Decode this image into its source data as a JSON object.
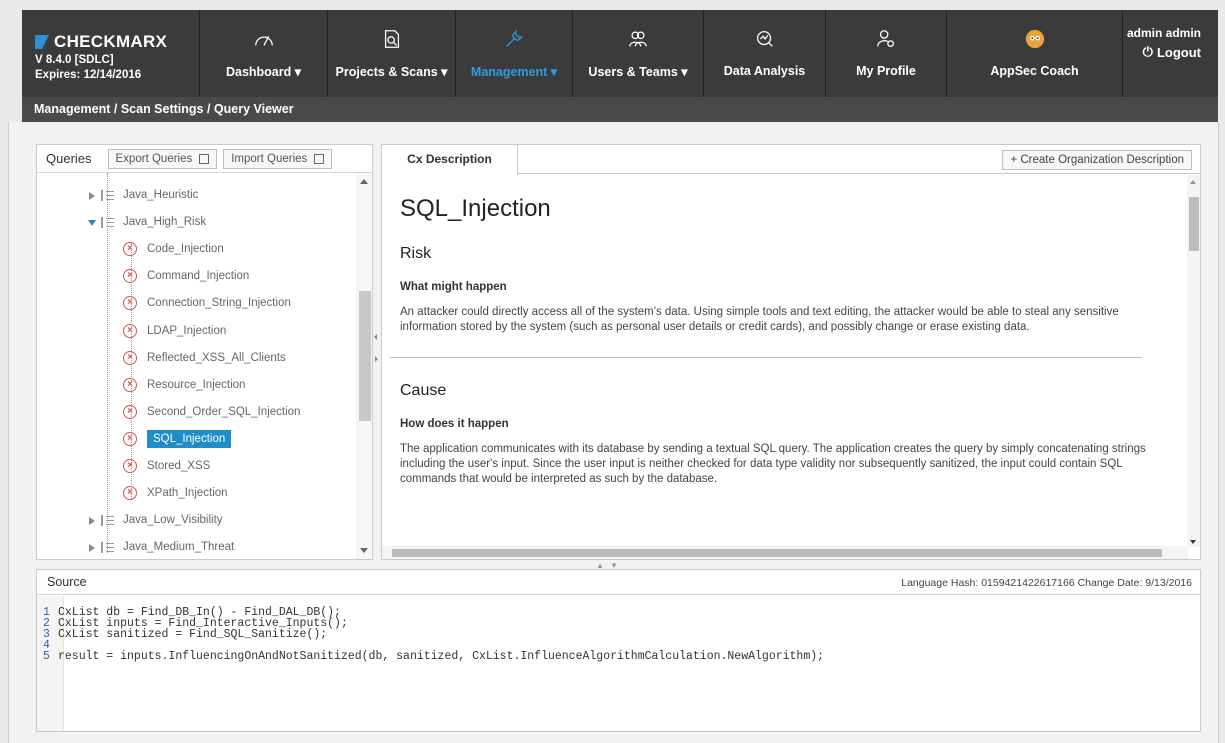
{
  "brand": {
    "name": "CHECKMARX",
    "version": "V 8.4.0  [SDLC]",
    "expires": "Expires: 12/14/2016"
  },
  "nav": [
    {
      "label": "Dashboard",
      "icon": "gauge-icon",
      "dropdown": true
    },
    {
      "label": "Projects & Scans",
      "icon": "document-search-icon",
      "dropdown": true
    },
    {
      "label": "Management",
      "icon": "wrench-icon",
      "dropdown": true,
      "active": true
    },
    {
      "label": "Users & Teams",
      "icon": "users-icon",
      "dropdown": true
    },
    {
      "label": "Data Analysis",
      "icon": "analysis-icon",
      "dropdown": false
    },
    {
      "label": "My Profile",
      "icon": "profile-gear-icon",
      "dropdown": false
    },
    {
      "label": "AppSec Coach",
      "icon": "owl-icon",
      "dropdown": false
    }
  ],
  "user": {
    "name": "admin admin",
    "logout": "Logout"
  },
  "breadcrumb": "Management / Scan Settings / Query Viewer",
  "queries": {
    "title": "Queries",
    "export_label": "Export Queries",
    "import_label": "Import Queries",
    "tree": [
      {
        "label": "Java_Heuristic",
        "type": "group"
      },
      {
        "label": "Java_High_Risk",
        "type": "group",
        "expanded": true
      },
      {
        "label": "Code_Injection",
        "type": "query"
      },
      {
        "label": "Command_Injection",
        "type": "query"
      },
      {
        "label": "Connection_String_Injection",
        "type": "query"
      },
      {
        "label": "LDAP_Injection",
        "type": "query"
      },
      {
        "label": "Reflected_XSS_All_Clients",
        "type": "query"
      },
      {
        "label": "Resource_Injection",
        "type": "query"
      },
      {
        "label": "Second_Order_SQL_Injection",
        "type": "query"
      },
      {
        "label": "SQL_Injection",
        "type": "query",
        "selected": true
      },
      {
        "label": "Stored_XSS",
        "type": "query"
      },
      {
        "label": "XPath_Injection",
        "type": "query"
      },
      {
        "label": "Java_Low_Visibility",
        "type": "group"
      },
      {
        "label": "Java_Medium_Threat",
        "type": "group"
      }
    ]
  },
  "description": {
    "tab": "Cx Description",
    "create_button": "+ Create Organization Description",
    "title": "SQL_Injection",
    "risk_heading": "Risk",
    "risk_sub": "What might happen",
    "risk_text": "An attacker could directly access all of the system's data. Using simple tools and text editing, the attacker would be able to steal any sensitive information stored by the system (such as personal user details or credit cards), and possibly change or erase existing data.",
    "cause_heading": "Cause",
    "cause_sub": "How does it happen",
    "cause_text": "The application communicates with its database by sending a textual SQL query. The application creates the query by simply concatenating strings including the user's input. Since the user input is neither checked for data type validity nor subsequently sanitized, the input could contain SQL commands that would be interpreted as such by the database."
  },
  "source": {
    "title": "Source",
    "meta": "Language Hash: 0159421422617166 Change Date: 9/13/2016",
    "lines": [
      {
        "num": "1",
        "code": "CxList db = Find_DB_In() - Find_DAL_DB();"
      },
      {
        "num": "2",
        "code": "CxList inputs = Find_Interactive_Inputs();"
      },
      {
        "num": "3",
        "code": "CxList sanitized = Find_SQL_Sanitize();"
      },
      {
        "num": "4",
        "code": ""
      },
      {
        "num": "5",
        "code": "result = inputs.InfluencingOnAndNotSanitized(db, sanitized, CxList.InfluenceAlgorithmCalculation.NewAlgorithm);"
      }
    ]
  },
  "colors": {
    "topbar": "#3b3b3b",
    "active": "#2f9be3",
    "selected": "#1f8dc7",
    "error": "#d9534f"
  }
}
